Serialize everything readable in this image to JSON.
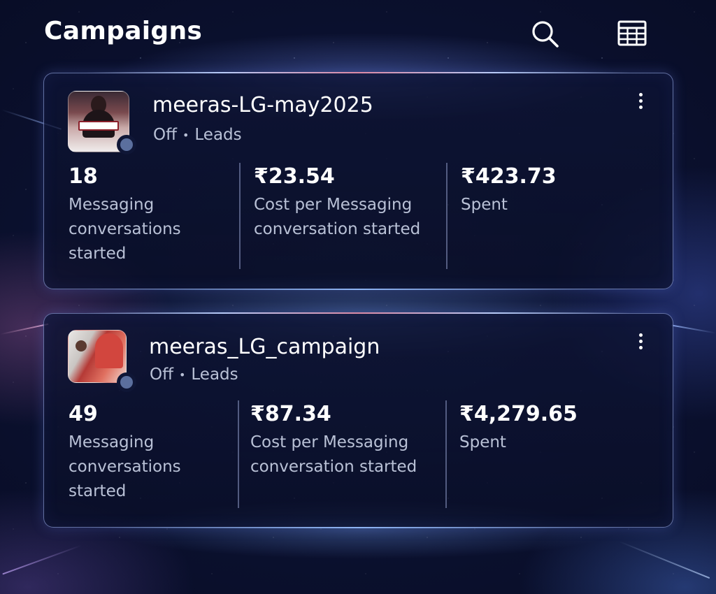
{
  "header": {
    "title": "Campaigns",
    "search_icon": "search-icon",
    "table_icon": "table-view-icon"
  },
  "colors": {
    "background": "#0b1130",
    "card_border": "#aabeff",
    "text_primary": "#ffffff",
    "text_secondary": "#b9c1d6",
    "status_dot": "#5b6f9e"
  },
  "campaigns": [
    {
      "name": "meeras-LG-may2025",
      "status": "Off",
      "separator": "•",
      "objective": "Leads",
      "more_icon": "more-vertical-icon",
      "metrics": [
        {
          "value": "18",
          "label": "Messaging conversations started"
        },
        {
          "value": "₹23.54",
          "label": "Cost per Messaging conversation started"
        },
        {
          "value": "₹423.73",
          "label": "Spent"
        }
      ]
    },
    {
      "name": "meeras_LG_campaign",
      "status": "Off",
      "separator": "•",
      "objective": "Leads",
      "more_icon": "more-vertical-icon",
      "metrics": [
        {
          "value": "49",
          "label": "Messaging conversations started"
        },
        {
          "value": "₹87.34",
          "label": "Cost per Messaging conversation started"
        },
        {
          "value": "₹4,279.65",
          "label": "Spent"
        }
      ]
    }
  ]
}
